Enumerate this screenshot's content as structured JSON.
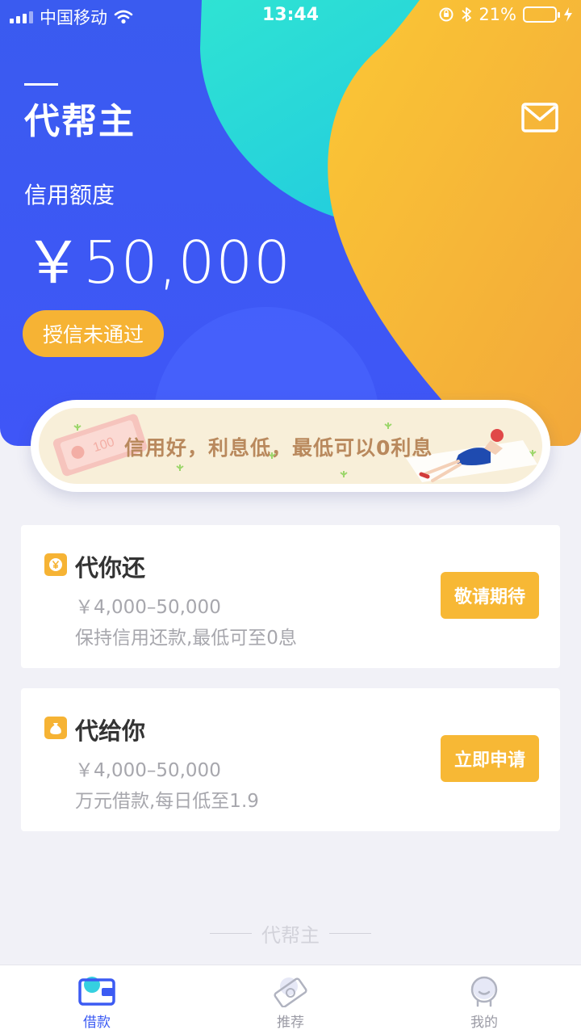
{
  "status_bar": {
    "carrier": "中国移动",
    "time": "13:44",
    "battery": "21%",
    "battery_level": 0.21
  },
  "header": {
    "app_name": "代帮主",
    "mail_icon": "mail-icon"
  },
  "credit": {
    "label": "信用额度",
    "amount": "￥50,000",
    "status": "授信未通过"
  },
  "banner": {
    "text": "信用好，利息低，最低可以0利息",
    "coupon_text": "100"
  },
  "products": [
    {
      "icon": "yen-coin-icon",
      "title": "代你还",
      "range": "￥4,000–50,000",
      "description": "保持信用还款,最低可至0息",
      "action": "敬请期待"
    },
    {
      "icon": "money-bag-icon",
      "title": "代给你",
      "range": "￥4,000–50,000",
      "description": "万元借款,每日低至1.9",
      "action": "立即申请"
    }
  ],
  "footer": {
    "brand": "代帮主"
  },
  "tab_bar": {
    "tabs": [
      {
        "label": "借款",
        "icon": "wallet-icon",
        "active": true
      },
      {
        "label": "推荐",
        "icon": "money-note-icon",
        "active": false
      },
      {
        "label": "我的",
        "icon": "profile-icon",
        "active": false
      }
    ]
  },
  "colors": {
    "hero_blue": "#3f56f7",
    "accent_orange": "#f6b334",
    "teal": "#27d7d6",
    "active_tab": "#3c5bf3"
  }
}
